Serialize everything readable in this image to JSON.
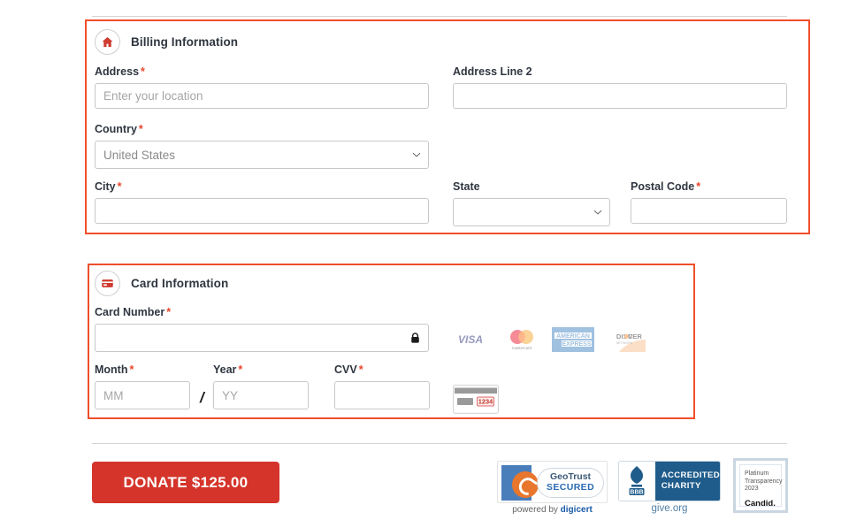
{
  "colors": {
    "highlight_border": "#f04f2a",
    "accent_red": "#d4342a",
    "required_star": "#e8462c",
    "label_text": "#2f3640",
    "input_border": "#c8c8c8",
    "divider": "#d4d4d4"
  },
  "billing": {
    "icon": "home-icon",
    "title": "Billing Information",
    "fields": {
      "address": {
        "label": "Address",
        "required": true,
        "value": "",
        "placeholder": "Enter your location"
      },
      "address2": {
        "label": "Address Line 2",
        "required": false,
        "value": "",
        "placeholder": ""
      },
      "country": {
        "label": "Country",
        "required": true,
        "value": "United States",
        "options": [
          "United States"
        ]
      },
      "city": {
        "label": "City",
        "required": true,
        "value": "",
        "placeholder": ""
      },
      "state": {
        "label": "State",
        "required": false,
        "value": "",
        "options": [
          ""
        ]
      },
      "postal": {
        "label": "Postal Code",
        "required": true,
        "value": "",
        "placeholder": ""
      }
    },
    "required_marker": "*"
  },
  "card": {
    "icon": "credit-card-icon",
    "title": "Card Information",
    "fields": {
      "number": {
        "label": "Card Number",
        "required": true,
        "value": "",
        "placeholder": "",
        "trailing_icon": "lock-icon"
      },
      "month": {
        "label": "Month",
        "required": true,
        "value": "",
        "placeholder": "MM"
      },
      "year": {
        "label": "Year",
        "required": true,
        "value": "",
        "placeholder": "YY"
      },
      "cvv": {
        "label": "CVV",
        "required": true,
        "value": "",
        "placeholder": ""
      }
    },
    "separator": "/",
    "accepted_brands": [
      {
        "name": "visa-logo",
        "label": "VISA"
      },
      {
        "name": "mastercard-logo",
        "label": "mastercard"
      },
      {
        "name": "amex-logo",
        "label": "AMERICAN EXPRESS"
      },
      {
        "name": "discover-logo",
        "label": "DISCOVER",
        "sub": "NETWORK"
      }
    ],
    "cvv_hint_icon": "card-back-cvv-icon",
    "cvv_hint_digits": "1234",
    "required_marker": "*"
  },
  "submit": {
    "label": "DONATE $125.00",
    "amount": "$125.00"
  },
  "trust_badges": {
    "geotrust": {
      "name": "geotrust-secured-badge",
      "line1": "GeoTrust",
      "line2": "SECURED",
      "footer_prefix": "powered by ",
      "footer_brand": "digicert"
    },
    "bbb": {
      "name": "bbb-accredited-charity-badge",
      "mark": "BBB",
      "line1": "ACCREDITED",
      "line2": "CHARITY",
      "footer": "give.org"
    },
    "candid": {
      "name": "candid-platinum-transparency-badge",
      "line1": "Platinum",
      "line2": "Transparency",
      "line3": "2023",
      "brand": "Candid."
    }
  }
}
